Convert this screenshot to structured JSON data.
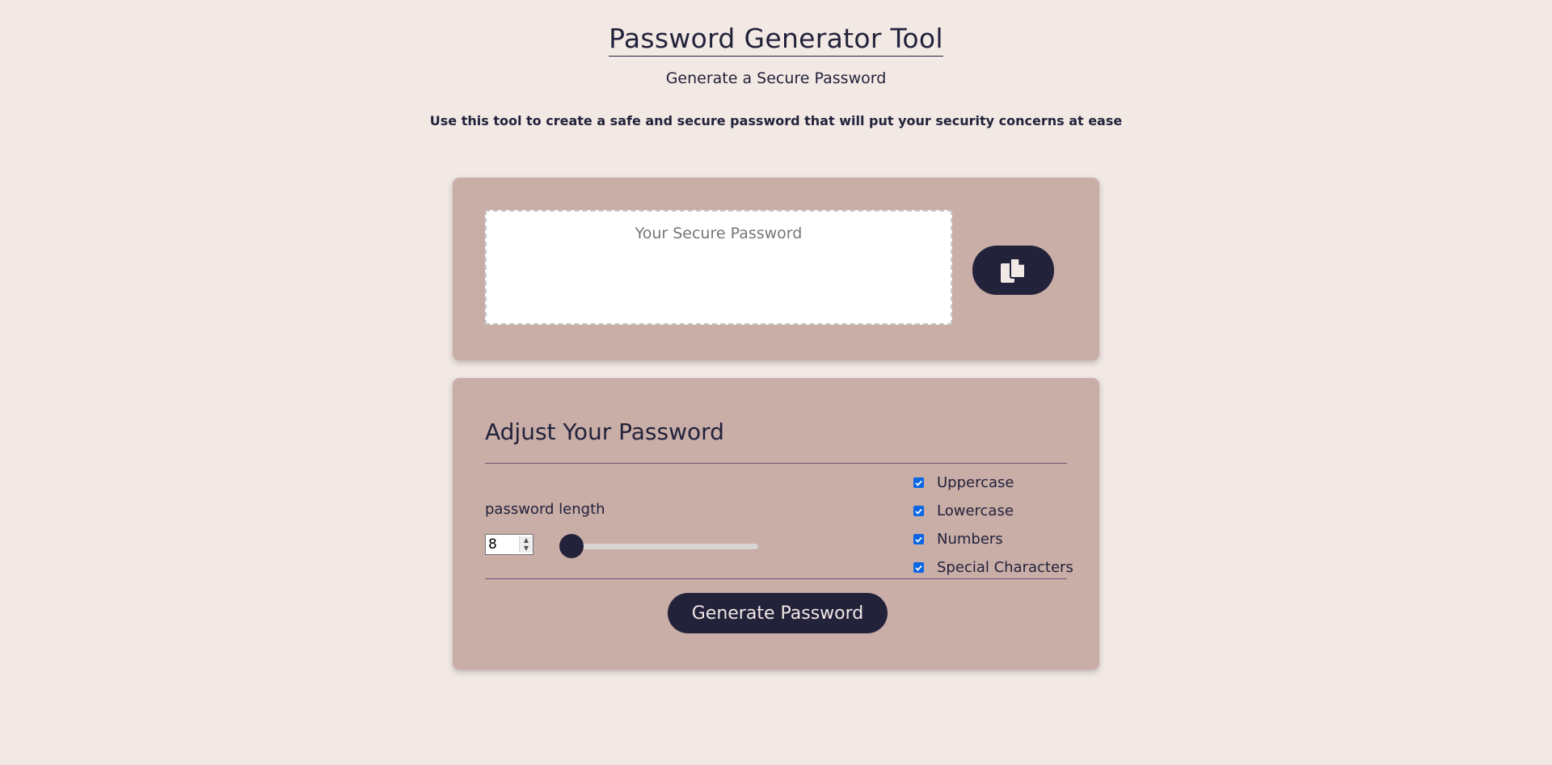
{
  "header": {
    "title": "Password Generator Tool",
    "subtitle": "Generate a Secure Password",
    "description": "Use this tool to create a safe and secure password that will put your security concerns at ease"
  },
  "password_card": {
    "placeholder": "Your Secure Password",
    "value": "",
    "copy_icon": "copy-icon"
  },
  "settings": {
    "title": "Adjust Your Password",
    "length_label": "password length",
    "length_value": "8",
    "slider_fraction": 0,
    "options": [
      {
        "label": "Uppercase",
        "checked": true
      },
      {
        "label": "Lowercase",
        "checked": true
      },
      {
        "label": "Numbers",
        "checked": true
      },
      {
        "label": "Special Characters",
        "checked": true
      }
    ],
    "generate_label": "Generate Password"
  },
  "colors": {
    "page_background": "#f2e8e4",
    "card_background": "#c9ada7",
    "primary": "#22223b",
    "checkbox": "#0b66e4"
  }
}
